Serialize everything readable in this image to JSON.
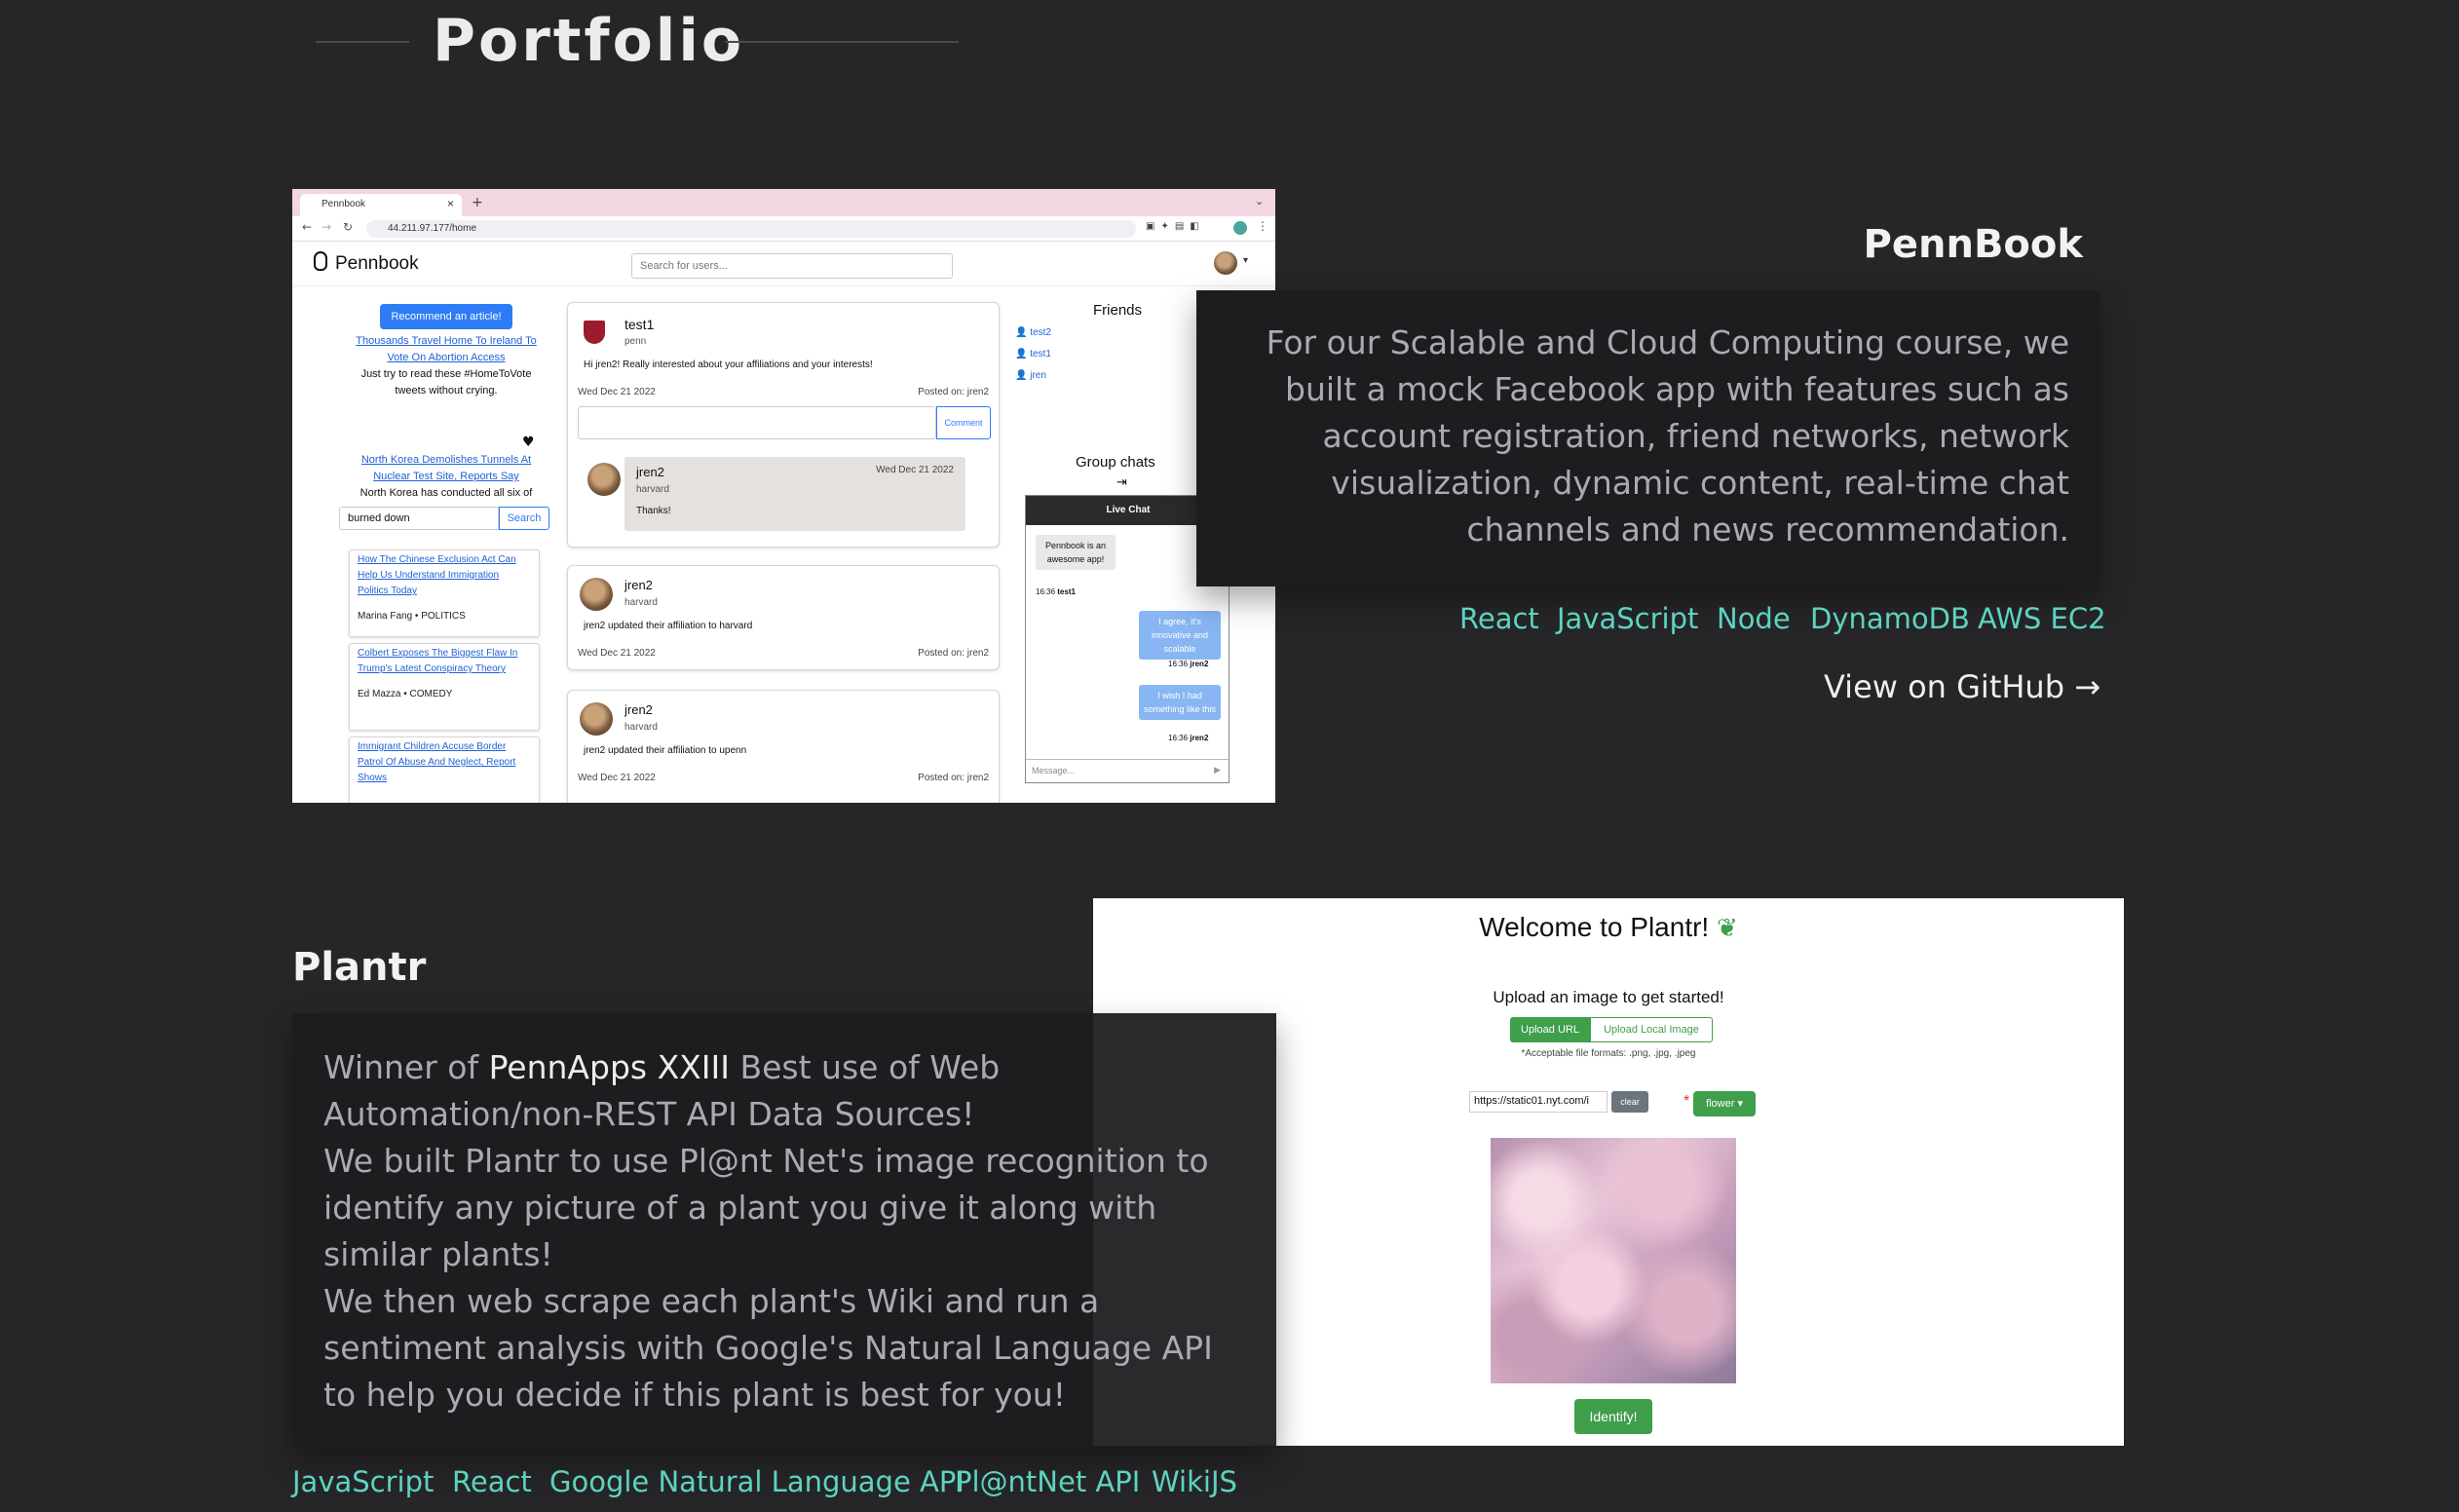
{
  "section": {
    "title": "Portfolio"
  },
  "projects": [
    {
      "title": "PennBook",
      "description": "For our Scalable and Cloud Computing course, we built a mock Facebook app with features such as account registration, friend networks, network visualization, dynamic content, real-time chat channels and news recommendation.",
      "tech": [
        "React",
        "JavaScript",
        "Node",
        "DynamoDB",
        "AWS EC2"
      ],
      "github_link": "View on GitHub →",
      "screenshot": {
        "tab_title": "Pennbook",
        "url": "44.211.97.177/home",
        "app_name": "Pennbook",
        "search_placeholder": "Search for users...",
        "recommend_button": "Recommend an article!",
        "news": [
          {
            "title": "Thousands Travel Home To Ireland To Vote On Abortion Access",
            "snippet": "Just try to read these #HomeToVote tweets without crying."
          },
          {
            "title": "North Korea Demolishes Tunnels At Nuclear Test Site, Reports Say",
            "snippet": "North Korea has conducted all six of"
          }
        ],
        "news_search_value": "burned down",
        "news_search_button": "Search",
        "news_list": [
          {
            "title": "How The Chinese Exclusion Act Can Help Us Understand Immigration Politics Today",
            "author": "Marina Fang",
            "category": "POLITICS"
          },
          {
            "title": "Colbert Exposes The Biggest Flaw In Trump's Latest Conspiracy Theory",
            "author": "Ed Mazza",
            "category": "COMEDY"
          },
          {
            "title": "Immigrant Children Accuse Border Patrol Of Abuse And Neglect, Report Shows",
            "author": "",
            "category": ""
          }
        ],
        "posts": [
          {
            "user": "test1",
            "affiliation": "penn",
            "text": "Hi jren2! Really interested about your affiliations and your interests!",
            "date": "Wed Dec 21 2022",
            "posted_on": "Posted on: jren2"
          },
          {
            "user": "jren2",
            "affiliation": "harvard",
            "text": "jren2 updated their affiliation to harvard",
            "date": "Wed Dec 21 2022",
            "posted_on": "Posted on: jren2"
          },
          {
            "user": "jren2",
            "affiliation": "harvard",
            "text": "jren2 updated their affiliation to upenn",
            "date": "Wed Dec 21 2022",
            "posted_on": "Posted on: jren2"
          }
        ],
        "comment_button": "Comment",
        "comment": {
          "user": "jren2",
          "affiliation": "harvard",
          "text": "Thanks!",
          "date": "Wed Dec 21 2022"
        },
        "friends_title": "Friends",
        "friends": [
          "test2",
          "test1",
          "jren"
        ],
        "group_chats_title": "Group chats",
        "live_chat_title": "Live Chat",
        "chat_messages": [
          {
            "text": "Pennbook is an awesome app!",
            "time": "16:36",
            "sender": "test1",
            "side": "left"
          },
          {
            "text": "I agree, it's innovative and scalable",
            "time": "16:36",
            "sender": "jren2",
            "side": "right"
          },
          {
            "text": "I wish I had something like this",
            "time": "16:36",
            "sender": "jren2",
            "side": "right"
          }
        ],
        "message_placeholder": "Message..."
      }
    },
    {
      "title": "Plantr",
      "description": {
        "p1_before": "Winner of ",
        "p1_highlight": "PennApps XXIII",
        "p1_after": " Best use of Web Automation/non-REST API Data Sources!",
        "p2": "We built Plantr to use Pl@nt Net's image recognition to identify any picture of a plant you give it along with similar plants!",
        "p3": "We then web scrape each plant's Wiki and run a sentiment analysis with Google's Natural Language API to help you decide if this plant is best for you!"
      },
      "tech": [
        "JavaScript",
        "React",
        "Google Natural Language API",
        "Pl@ntNet API",
        "WikiJS"
      ],
      "screenshot": {
        "heading": "Welcome to Plantr!",
        "subheading": "Upload an image to get started!",
        "upload_url_button": "Upload URL",
        "upload_local_button": "Upload Local Image",
        "formats_note": "*Acceptable file formats: .png, .jpg, .jpeg",
        "url_value": "https://static01.nyt.com/i",
        "clear_button": "clear",
        "required_mark": "*",
        "organ_dropdown": "flower",
        "identify_button": "Identify!"
      }
    }
  ],
  "colors": {
    "background": "#262628",
    "accent": "#5ed3c0",
    "panel": "#1d1d1f"
  }
}
